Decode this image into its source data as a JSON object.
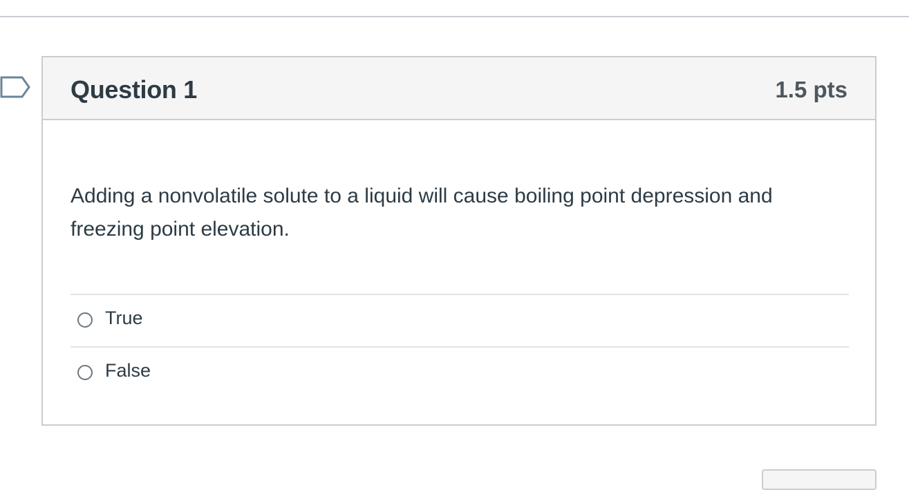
{
  "question": {
    "title": "Question 1",
    "points": "1.5 pts",
    "text": "Adding a nonvolatile solute to a liquid will cause boiling point depression and freezing point elevation.",
    "answers": [
      {
        "label": "True",
        "selected": false
      },
      {
        "label": "False",
        "selected": false
      }
    ]
  },
  "icons": {
    "flag": "flag-question-icon"
  },
  "colors": {
    "text": "#2d3b45",
    "header_bg": "#f5f5f5",
    "border": "#c7cdd1",
    "flag_stroke": "#6a8599"
  }
}
